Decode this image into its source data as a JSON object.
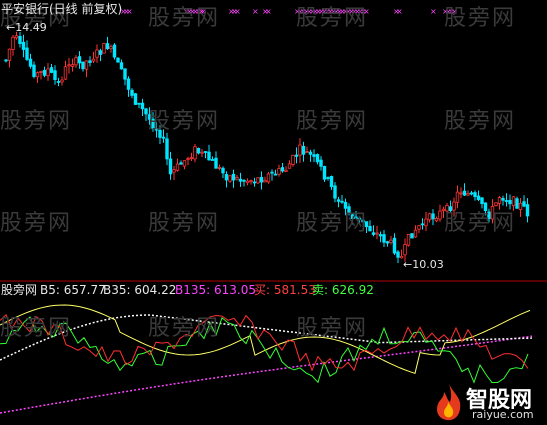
{
  "header": {
    "title": "平安银行(日线 前复权)"
  },
  "price": {
    "high_label": "14.49",
    "low_label": "10.03"
  },
  "indicator": {
    "name": "股旁网",
    "items": [
      {
        "label": "B5: 657.77",
        "color": "#e8e8e8"
      },
      {
        "label": "B35: 604.22",
        "color": "#e8e8e8"
      },
      {
        "label": "B135: 613.05",
        "color": "#ff44ff"
      },
      {
        "label": "买: 581.53",
        "color": "#ff4040"
      },
      {
        "label": "卖: 626.92",
        "color": "#44ff44"
      }
    ]
  },
  "watermark": "股旁网",
  "logo": {
    "name": "智股网",
    "domain": "raiyue.com"
  },
  "colors": {
    "up": "#ff3333",
    "down": "#00e5ff",
    "pink": "#ff44ff",
    "yellow": "#ffff66",
    "white": "#ffffff",
    "green": "#33ff33",
    "red": "#ff3030"
  }
}
